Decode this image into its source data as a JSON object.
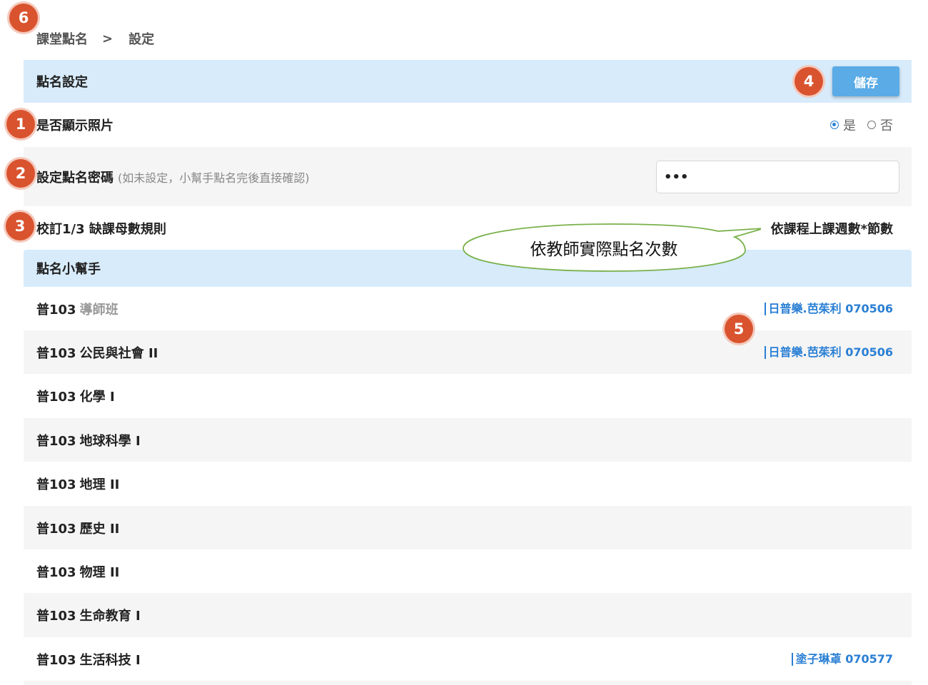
{
  "breadcrumb": {
    "root": "課堂點名",
    "separator": ">",
    "current": "設定"
  },
  "badges": [
    "1",
    "2",
    "3",
    "4",
    "5",
    "6"
  ],
  "settings": {
    "title": "點名設定",
    "save_label": "儲存",
    "show_photo": {
      "label": "是否顯示照片",
      "yes": "是",
      "no": "否",
      "selected": "是"
    },
    "password": {
      "label": "設定點名密碼",
      "hint": "(如未設定，小幫手點名完後直接確認)",
      "value": "•••"
    },
    "rule": {
      "label": "校訂1/3 缺課母數規則",
      "value": "依課程上課週數*節數"
    }
  },
  "callout": {
    "text": "依教師實際點名次數"
  },
  "helper": {
    "title": "點名小幫手",
    "courses": [
      {
        "name": "普103",
        "subject": "導師班",
        "teacher": "日普樂.芭茱利",
        "code": "070506"
      },
      {
        "name": "普103",
        "subject": "公民與社會 II",
        "teacher": "日普樂.芭茱利",
        "code": "070506"
      },
      {
        "name": "普103",
        "subject": "化學 I",
        "teacher": "",
        "code": ""
      },
      {
        "name": "普103",
        "subject": "地球科學 I",
        "teacher": "",
        "code": ""
      },
      {
        "name": "普103",
        "subject": "地理 II",
        "teacher": "",
        "code": ""
      },
      {
        "name": "普103",
        "subject": "歷史 II",
        "teacher": "",
        "code": ""
      },
      {
        "name": "普103",
        "subject": "物理 II",
        "teacher": "",
        "code": ""
      },
      {
        "name": "普103",
        "subject": "生命教育 I",
        "teacher": "",
        "code": ""
      },
      {
        "name": "普103",
        "subject": "生活科技 I",
        "teacher": "塗子琳䓬",
        "code": "070577"
      }
    ]
  },
  "colors": {
    "accent": "#2a7fd4",
    "header_bg": "#d7ebfb",
    "badge": "#d9532f",
    "save": "#5aabe6"
  }
}
